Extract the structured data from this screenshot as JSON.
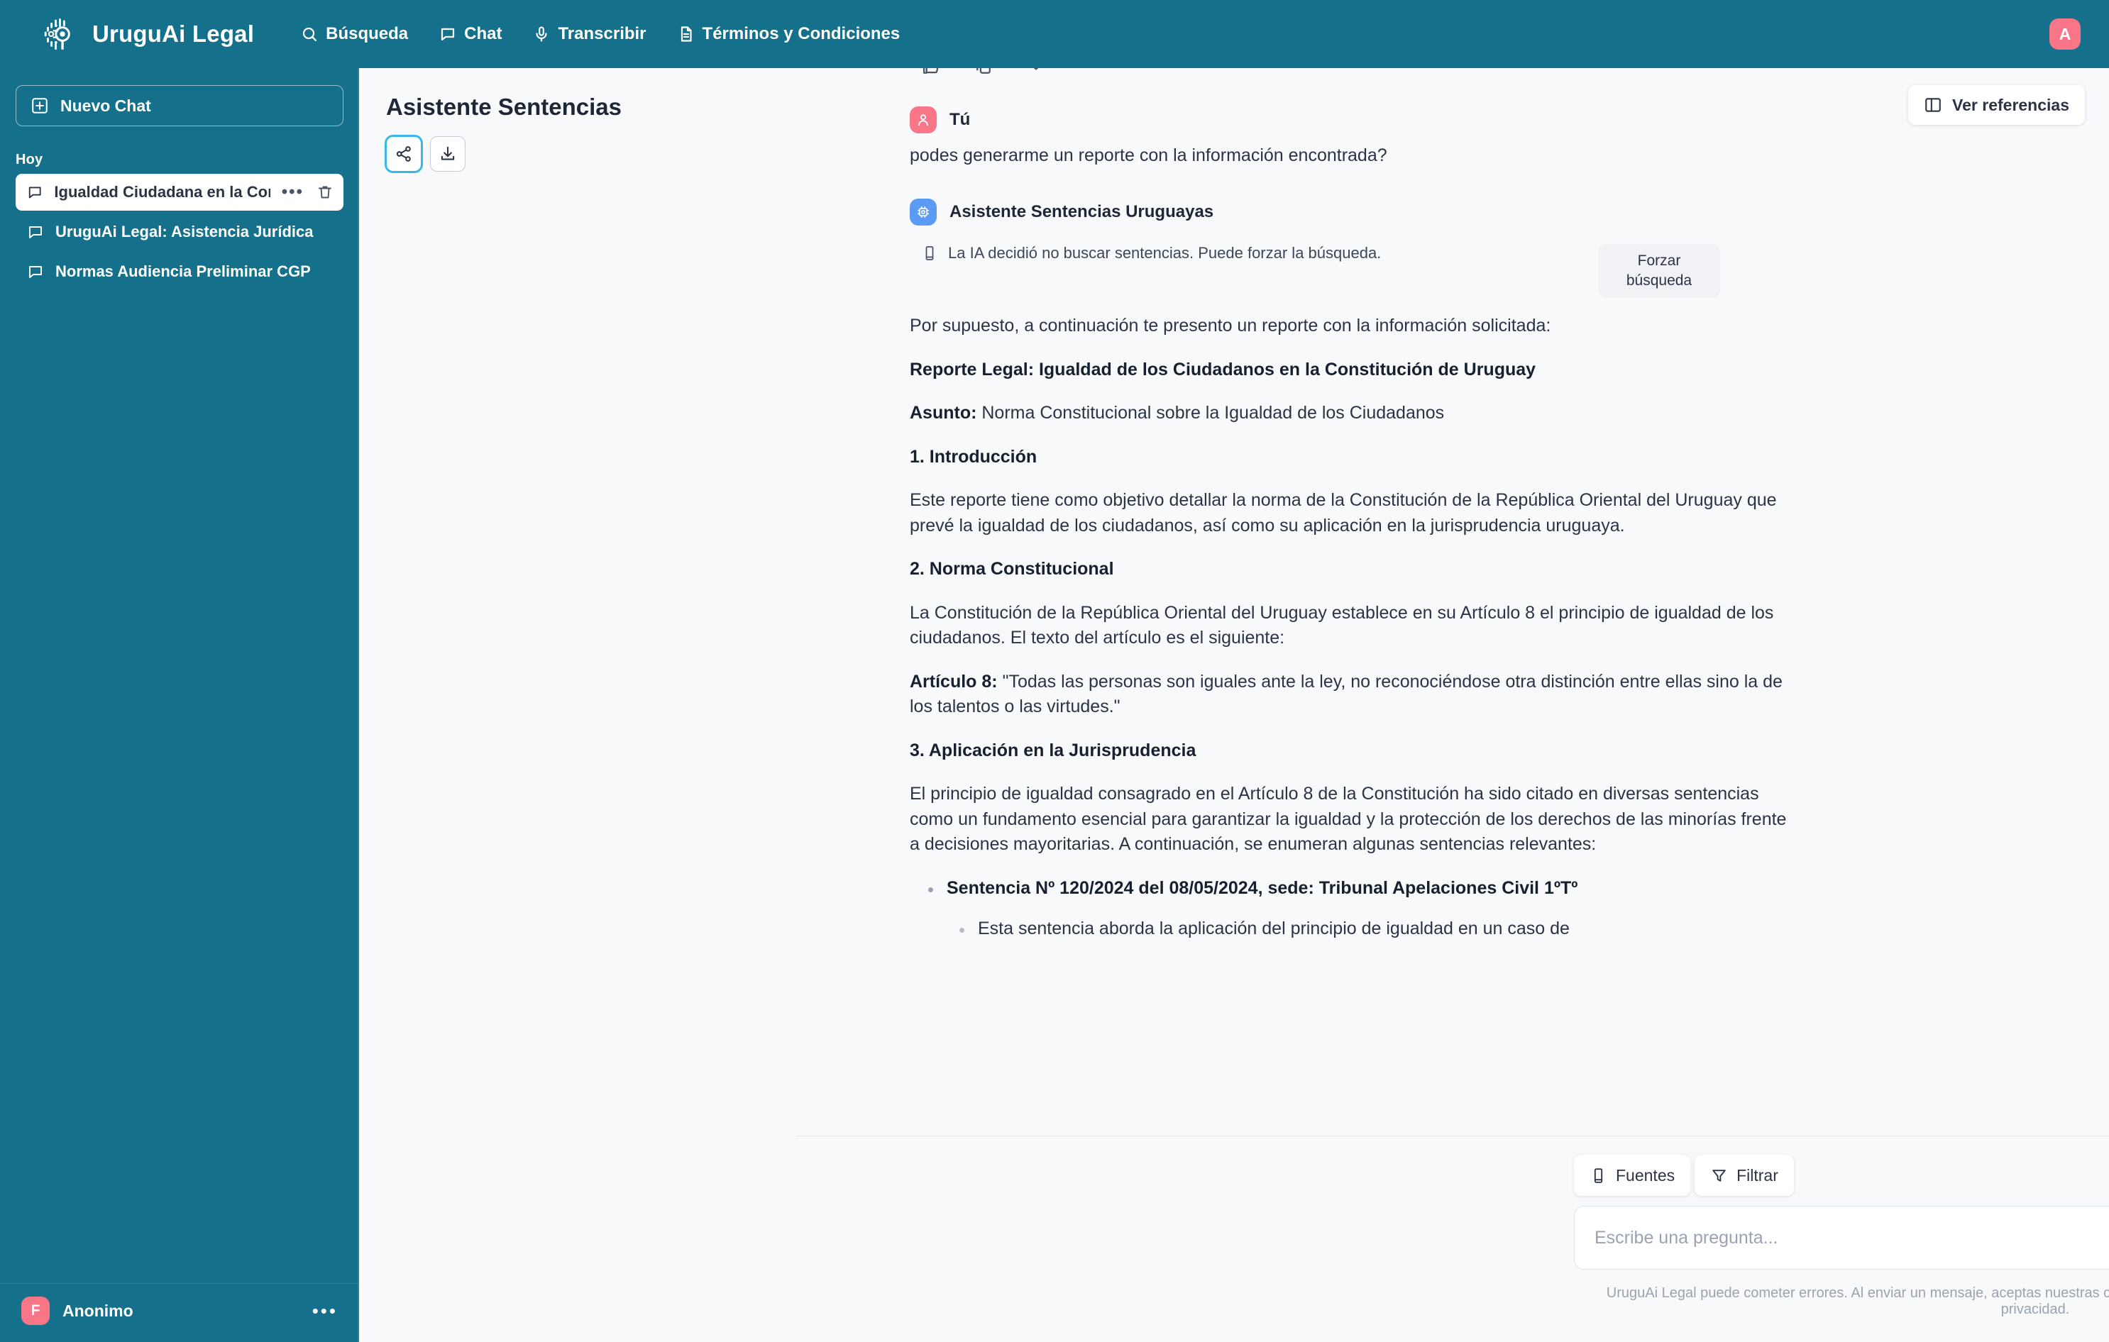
{
  "brand": {
    "name": "UruguAi Legal",
    "logo_icon": "circuit-logo-icon"
  },
  "topnav": [
    {
      "label": "Búsqueda",
      "icon": "search-icon"
    },
    {
      "label": "Chat",
      "icon": "chat-bubble-icon"
    },
    {
      "label": "Transcribir",
      "icon": "microphone-icon"
    },
    {
      "label": "Términos y Condiciones",
      "icon": "document-icon"
    }
  ],
  "account": {
    "initial": "A",
    "color": "#f87687"
  },
  "sidebar": {
    "new_chat_label": "Nuevo Chat",
    "section_label": "Hoy",
    "items": [
      {
        "label": "Igualdad Ciudadana en la Cons",
        "active": true
      },
      {
        "label": "UruguAi Legal: Asistencia Jurídica",
        "active": false
      },
      {
        "label": "Normas Audiencia Preliminar CGP",
        "active": false
      }
    ],
    "more_dots": "•••",
    "footer": {
      "initial": "F",
      "name": "Anonimo",
      "dots": "•••"
    }
  },
  "left_pane": {
    "title": "Asistente Sentencias",
    "share_label": "share-button",
    "download_label": "download-button"
  },
  "references_button": {
    "label": "Ver referencias",
    "icon": "panel-right-icon"
  },
  "conversation": {
    "user": {
      "author": "Tú",
      "avatar_initial": "",
      "text": "podes generarme un reporte con la información encontrada?"
    },
    "assistant": {
      "author": "Asistente Sentencias Uruguayas",
      "notice": "La IA decidió no buscar sentencias. Puede forzar la búsqueda.",
      "force_button": "Forzar búsqueda",
      "intro": "Por supuesto, a continuación te presento un reporte con la información solicitada:",
      "report_title": "Reporte Legal: Igualdad de los Ciudadanos en la Constitución de Uruguay",
      "subject_label": "Asunto:",
      "subject_value": "Norma Constitucional sobre la Igualdad de los Ciudadanos",
      "section1_title": "1. Introducción",
      "section1_body": "Este reporte tiene como objetivo detallar la norma de la Constitución de la República Oriental del Uruguay que prevé la igualdad de los ciudadanos, así como su aplicación en la jurisprudencia uruguaya.",
      "section2_title": "2. Norma Constitucional",
      "section2_body": "La Constitución de la República Oriental del Uruguay establece en su Artículo 8 el principio de igualdad de los ciudadanos. El texto del artículo es el siguiente:",
      "article_label": "Artículo 8:",
      "article_quote": "\"Todas las personas son iguales ante la ley, no reconociéndose otra distinción entre ellas sino la de los talentos o las virtudes.\"",
      "section3_title": "3. Aplicación en la Jurisprudencia",
      "section3_body": "El principio de igualdad consagrado en el Artículo 8 de la Constitución ha sido citado en diversas sentencias como un fundamento esencial para garantizar la igualdad y la protección de los derechos de las minorías frente a decisiones mayoritarias. A continuación, se enumeran algunas sentencias relevantes:",
      "bullet1": "Sentencia Nº 120/2024 del 08/05/2024, sede: Tribunal Apelaciones Civil 1ºTº",
      "bullet1_sub": "Esta sentencia aborda la aplicación del principio de igualdad en un caso de"
    }
  },
  "composer": {
    "chips": [
      {
        "label": "Fuentes",
        "icon": "book-icon"
      },
      {
        "label": "Filtrar",
        "icon": "filter-icon"
      }
    ],
    "placeholder": "Escribe una pregunta...",
    "value": "",
    "send_icon": "send-arrow-icon",
    "disclaimer": "UruguAi Legal puede cometer errores. Al enviar un mensaje, aceptas nuestras condiciones y confirmas que has leído nuestra política de privacidad."
  },
  "colors": {
    "brand_teal": "#15708c",
    "accent_pink": "#f87687",
    "bot_blue": "#5b9bf3",
    "focus_cyan": "#37b6e9"
  }
}
